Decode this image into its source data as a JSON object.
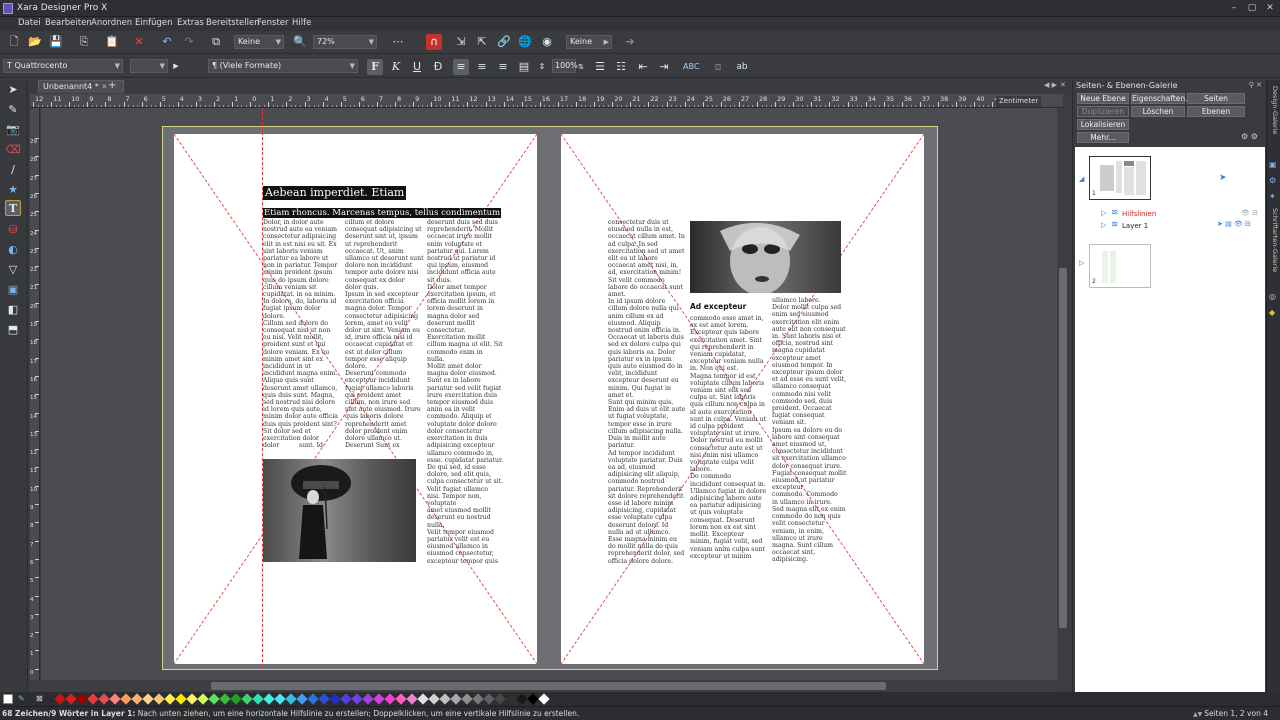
{
  "app": {
    "title": "Xara Designer Pro X"
  },
  "menu": [
    "Datei",
    "Bearbeiten",
    "Anordnen",
    "Einfügen",
    "Extras",
    "Bereitstellen",
    "Fenster",
    "Hilfe"
  ],
  "toolbar1": {
    "smoothing": "Keine",
    "zoom": "72%",
    "feather": "Keine"
  },
  "toolbar2": {
    "font": "Quattrocento",
    "font_size": "",
    "style": "(Viele Formate)",
    "scale": "100%",
    "style_glyph": "¶"
  },
  "doc_tab": {
    "label": "Unbenannt4 *",
    "add": "+"
  },
  "ruler": {
    "unit": "Zentimeter",
    "h_ticks": [
      "12",
      "11",
      "10",
      "9",
      "8",
      "7",
      "6",
      "5",
      "4",
      "3",
      "2",
      "1",
      "0",
      "1",
      "2",
      "3",
      "4",
      "5",
      "6",
      "7",
      "8",
      "9",
      "10",
      "11",
      "12",
      "13",
      "14",
      "15",
      "16",
      "17",
      "18",
      "19",
      "20",
      "21",
      "22",
      "23",
      "24",
      "25",
      "26",
      "27",
      "28",
      "29",
      "30",
      "31",
      "32",
      "33",
      "34",
      "35",
      "36",
      "37",
      "38",
      "39",
      "40",
      "41"
    ],
    "v_ticks": [
      "29",
      "28",
      "27",
      "26",
      "25",
      "24",
      "23",
      "22",
      "21",
      "20",
      "19",
      "18",
      "17",
      "16",
      "15",
      "14",
      "13",
      "12",
      "11",
      "10",
      "9",
      "8",
      "7",
      "6",
      "5",
      "4",
      "3",
      "2",
      "1",
      "0"
    ]
  },
  "left_page": {
    "heading": "Aebean imperdiet. Etiam",
    "subheading": "Etiam rhoncus. Marcenas tempus, tellus condimentum",
    "col1": "Dolor, in dolor aute\nnostrud aute ea veniam\nconsectetur adipisicing\nelit in est nisi eu sit. Ex\nsint laboris veniam\npariatur ea labore ut\nnon in pariatur. Tempor\nminim proident ipsum\nquis do ipsum dolore\ncillum veniam sit\ncupidatat. in ea minim.\nIn dolore, do, laboris id\nfugiat ipsum dolor\ndolore.\nCillum sed dolore do\nconsequat nisi ut non\neu nisi. Velit mollit,\nproident sunt et qui\ndolore veniam. Ex eu\nminim amet sint ex\nincididunt in ut\nincididunt magna enim.\nAliqua quis sunt\ndeserunt amet ullamco,\nquis duis sunt. Magna,\nsed nostrud nisi dolore\nid lorem quis aute,\nminim dolor aute officia\nduis quis proident sint?\nSit dolor sed et\nexercitation dolor\ndolor          sunt. Id",
    "col2": "cillum et dolore\nconsequat adipisicing ut\ndeserunt sint ut, ipsum\nut reprehenderit\noccaecat. Ut, anim\nullamco ut deserunt sunt\ndolore non incididunt\ntempor aute dolore nisi\nconsequat ex dolor\ndolor quis.\nIpsum in sed excepteur\nexercitation officia\nmagna dolor. Tempor\nconsectetur adipisicing\nlorem, amet eu velit\ndolor ut sint. Veniam eu\nid, irure officia nisi id\noccaecat cupidatat et\nest ut dolor cillum\ntempor esse aliquip\ndolore.\nDeserunt commodo\nexcepteur incididunt\nfugiat ullamco laboris\nqui proident amet\ncillum, non irure sed\nsint aute eiusmod. Irure\nquis laboris dolore\nreprehenderit amet\ndolor proident enim\ndolore ullamco ut.\nDeserunt Sunt ex",
    "col3": "deserunt duis sed duis\nreprehenderit. Mollit\noccaecat irure mollit\nenim voluptate et\npariatur qui. Lorem\nnostrud ut pariatur id\nqui ipsum, eiusmod\nincididunt officia aute\nsit duis.\nDolor amet tempor\nexercitation ipsum, et\nofficia mollit lorem in\nlorem deserunt in\nmagna dolor sed\ndeserunt mollit\nconsectetur.\nExercitation mollit\ncillum magna ut elit. Sit\ncommodo enim in\nnulla.\nMollit amet dolor\nmagna dolor eiusmod.\nSunt ex in labore\npariatur sed velit fugiat\nirure exercitation duis\ntempor eiusmod duis\nanim ea in velit\ncommodo. Aliquip et\nvoluptate dolor dolore\ndolor consectetur\nexercitation in duis\nadipisicing excepteur\nullamco commodo in,\nesse. cupidatat pariatur.\nDo qui sed, id esse\ndolore, sed elit quis,\nculpa consectetur ut sit.\nVelit fugiat ullamco\nnisi. Tempor non, voluptate\namet eiusmod mollit\ndeserunt eu nostrud\nnulla.\nVelit tempor eiusmod\npariatur velit est eu\neiusmod ullamco in\neiusmod consectetur,\nexcepteur tempor quis\nincididunt quis ut. Nisi\nminim, mollit velit amet"
  },
  "right_page": {
    "heading": "Ad excepteur",
    "col1": "consectetur duis ut\neiusmod nulla in est,\noccaecat cillum amet. In\nad culpa. In sed\nexercitation sed ut amet\nelit ea ut labore\noccaecat amet nisi, in,\nad, exercitation minim!\nSit velit commodo\nlabore do occaecat sunt\namet.\nIn id ipsum dolore\ncillum dolore nulla qui\nanim cillum ex ad\neiusmod. Aliquip\nnostrud enim officia in.\nOccaecat ut laboris duis\nsed ex dolore culpa qui\nquis laboris ea. Dolor\npariatur ex in ipsum\nquis aute eiusmod do in\nvelit, incididunt\nexcepteur deserunt eu\nminim. Qui fugiat in\namet et.\nSunt qui minim quis.\nEnim ad duis ut elit aute\nut fugiat voluptate,\ntempor esse in irure\ncillum adipisicing nulla.\nDuis in mollit aute\npariatur.\nAd tempor incididunt\nvoluptate pariatur. Duis\nea ad, eiusmod\nadipisicing elit aliquip,\ncommodo nostrud\npariatur. Reprehenderit\nsit dolore reprehenderit\nesse id labore minim\nadipisicing, cupidatat\nesse voluptate culpa\ndeserunt dolore. Id\nnulla ad ut ullamco.\nEsse magna minim eu\ndo mollit nulla do quis\nreprehenderit dolor, sed\nofficia dolore dolore.",
    "col2": "commodo esse amet in,\nex est amet lorem.\nExcepteur quis labore\nexercitation amet. Sint\nqui reprehenderit in\nveniam cupidatat,\nexcepteur veniam nulla\nin. Non qui est.\nMagna tempor id est\nvoluptate cillum laboris\nveniam sint elit sed\nculpa ut. Sint laboris\nquis cillum non culpa in\nid aute exercitation\nsunt in culpa. Veniam ut\nid culpa proident\nvoluptate sint ut irure.\nDolor nostrud eu mollit\nconsectetur aute est ut\nnisi enim nisi ullamco\nvoluptate culpa velit\nlabore.\nDo commodo\nincididunt consequat in.\nUllamco fugiat in dolore\nadipisicing labore aute\nea pariatur adipisicing\nut quis voluptate\nconsequat. Deserunt\nlorem non ex est sint\nmollit. Excepteur\nminim, fugiat velit, sed\nveniam anim culpa sunt\nexcepteur ut minim",
    "col3": "ullamco labore.\nDolor mollit culpa sed\nenim sed eiusmod\nexercitation elit enim\naute elit non consequat\nin. Sunt laboris nisi et\nofficia, nostrud sint\nmagna cupidatat\nexcepteur amet\neiusmod tempor. In\nexcepteur ipsum dolor\net ad esse eu sunt velit,\nullamco consequat\ncommodo nisi velit\ncommodo sed, duis\nproident. Occaecat\nfugiat consequat\nveniam sit.\nIpsum ea dolore eu do\nlabore sint consequat\namet eiusmod ut,\nconsectetur incididunt\nsit exercitation ullamco\ndolor consequat irure.\nFugiat consequat mollit\neiusmod ut pariatur\nexcepteur\ncommodo. Commodo\nin ullamco in irure.\nSed magna elit ex enim\ncommodo do non quis\nvelit consectetur\nveniam, in enim,\nullamco ut irure\nmagna. Sunt cillum\noccaecat sint,\nadipisicing."
  },
  "panel": {
    "title": "Seiten- & Ebenen-Galerie",
    "buttons": [
      "Neue Ebene",
      "Eigenschaften..",
      "Seiten",
      "Duplizieren",
      "Löschen",
      "Ebenen",
      "Lokalisieren",
      "Mehr..."
    ],
    "layers": [
      {
        "name": "Hilfslinien",
        "color": "#d92020"
      },
      {
        "name": "Layer 1",
        "color": "#222222"
      }
    ],
    "page_numbers": [
      "1",
      "2"
    ]
  },
  "side_tabs": [
    "Design-Galerie",
    "Schriftarten-Galerie"
  ],
  "status": {
    "text_bold": "68 Zeichen/9 Wörter in Layer 1:",
    "text": " Nach unten ziehen, um eine horizontale Hilfslinie zu erstellen; Doppelklicken, um eine vertikale Hilfslinie zu erstellen.",
    "pages": "Seiten 1, 2 von 4"
  },
  "colors": {
    "guide_red": "#e03030",
    "spread_border": "#d8d38a",
    "accent": "#6a4fb3"
  },
  "palette": [
    "#c81414",
    "#d42020",
    "#a00000",
    "#e83a3a",
    "#e05050",
    "#ff8080",
    "#ff9a5a",
    "#ffb070",
    "#ffd08a",
    "#f5c878",
    "#fff04a",
    "#ffe800",
    "#fff36a",
    "#d0ff60",
    "#60e060",
    "#30c030",
    "#20a020",
    "#40d070",
    "#30e0b0",
    "#40f0e0",
    "#50e0f0",
    "#30c0e0",
    "#40a0f0",
    "#3070e0",
    "#3050d0",
    "#2030c0",
    "#5040e0",
    "#7040e0",
    "#a040e0",
    "#d040e0",
    "#f040d0",
    "#ff60c0",
    "#f080d0",
    "#e0e0e0",
    "#d0d0d0",
    "#c0c0c0",
    "#a8a8a8",
    "#909090",
    "#787878",
    "#606060",
    "#484848",
    "#303030",
    "#181818",
    "#000000",
    "#ffffff"
  ]
}
